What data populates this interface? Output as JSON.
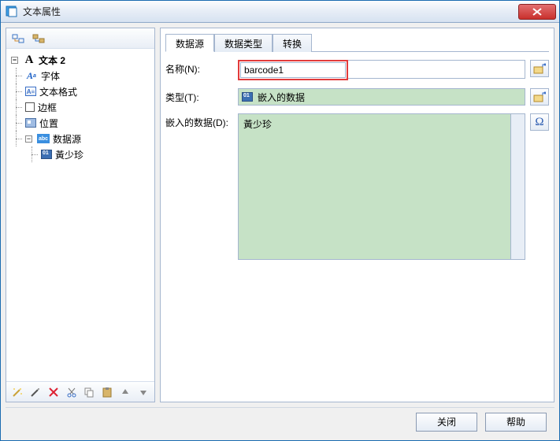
{
  "window": {
    "title": "文本属性"
  },
  "tree": {
    "root": "文本 2",
    "items": [
      {
        "label": "字体"
      },
      {
        "label": "文本格式"
      },
      {
        "label": "边框"
      },
      {
        "label": "位置"
      },
      {
        "label": "数据源",
        "children": [
          {
            "label": "黃少珍"
          }
        ]
      }
    ]
  },
  "tabs": [
    {
      "label": "数据源",
      "active": true
    },
    {
      "label": "数据类型",
      "active": false
    },
    {
      "label": "转换",
      "active": false
    }
  ],
  "form": {
    "name_label": "名称(N):",
    "name_value": "barcode1",
    "type_label": "类型(T):",
    "type_value": "嵌入的数据",
    "embed_label": "嵌入的数据(D):",
    "embed_value": "黃少珍"
  },
  "footer": {
    "close": "关闭",
    "help": "帮助"
  },
  "icons": {
    "wand": "wand-icon",
    "wizard": "wizard-icon",
    "delete": "delete-icon",
    "cut": "cut-icon",
    "copy": "copy-icon",
    "paste": "paste-icon",
    "up": "arrow-up-icon",
    "down": "arrow-down-icon",
    "map1": "map-toggle-icon",
    "map2": "map-copy-icon",
    "pick": "picker-icon",
    "omega": "omega-icon"
  }
}
